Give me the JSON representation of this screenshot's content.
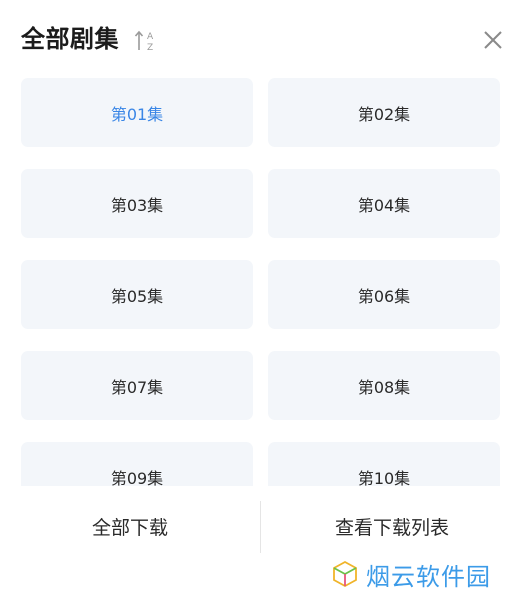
{
  "header": {
    "title": "全部剧集",
    "sort_icon": "sort-a-z-icon",
    "sort_letters": [
      "A",
      "Z"
    ],
    "close_icon": "close-icon"
  },
  "episodes": [
    {
      "label": "第01集",
      "active": true
    },
    {
      "label": "第02集",
      "active": false
    },
    {
      "label": "第03集",
      "active": false
    },
    {
      "label": "第04集",
      "active": false
    },
    {
      "label": "第05集",
      "active": false
    },
    {
      "label": "第06集",
      "active": false
    },
    {
      "label": "第07集",
      "active": false
    },
    {
      "label": "第08集",
      "active": false
    },
    {
      "label": "第09集",
      "active": false
    },
    {
      "label": "第10集",
      "active": false
    }
  ],
  "footer": {
    "download_all": "全部下载",
    "view_downloads": "查看下载列表"
  },
  "watermark": {
    "text": "烟云软件园",
    "logo_icon": "cube-logo-icon"
  },
  "colors": {
    "accent": "#3a86e6",
    "tile_bg": "#f3f6fa",
    "text": "#2a2a2a",
    "watermark": "#3c9be8"
  }
}
